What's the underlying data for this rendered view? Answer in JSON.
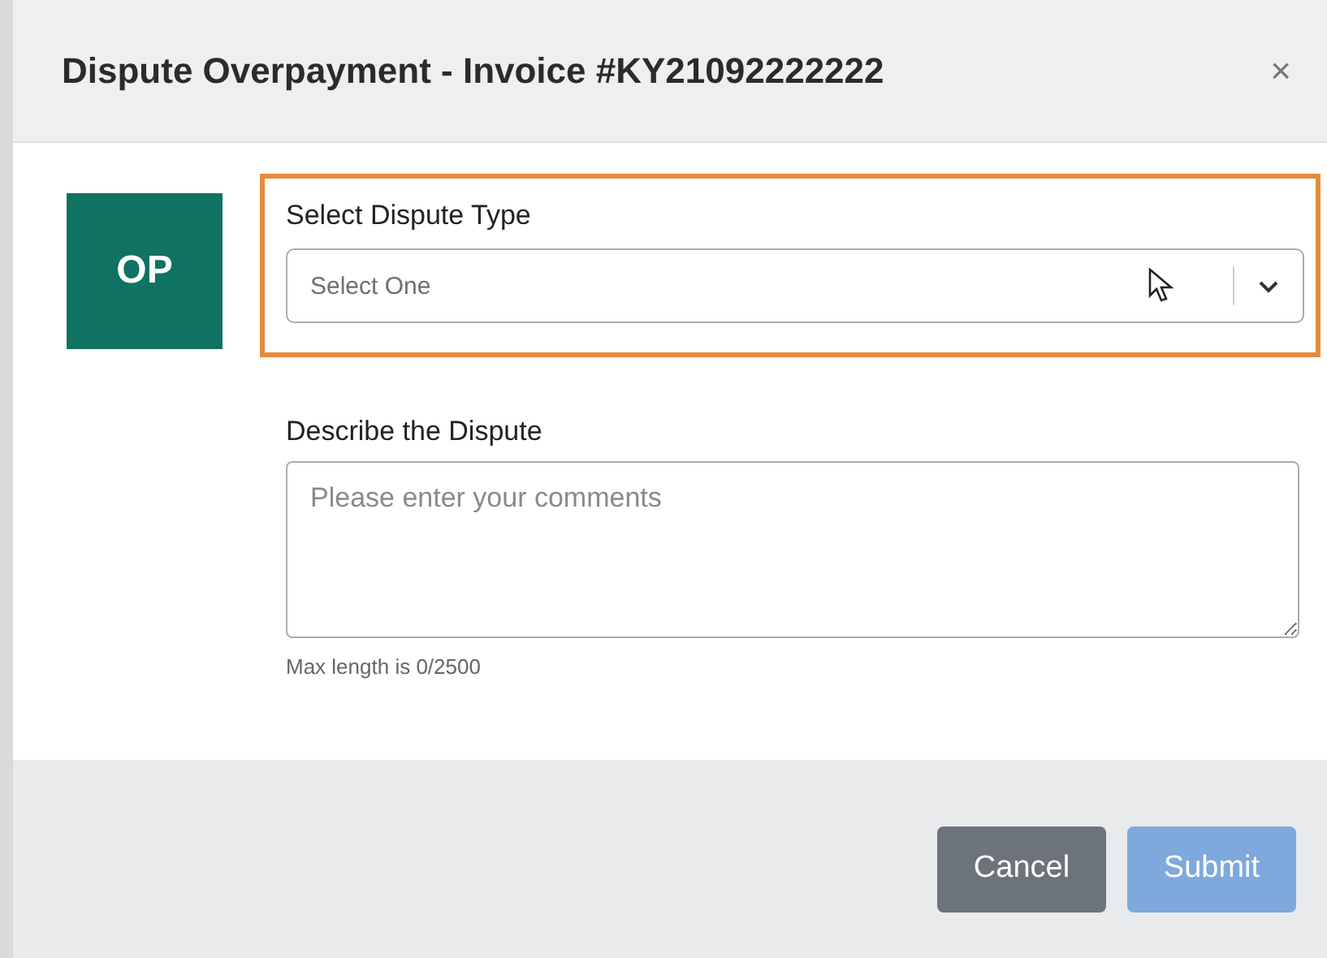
{
  "dialog": {
    "title": "Dispute Overpayment - Invoice #KY21092222222",
    "close": "×"
  },
  "badge": "OP",
  "dispute_type": {
    "label": "Select Dispute Type",
    "placeholder": "Select One",
    "highlighted": true
  },
  "description": {
    "label": "Describe the Dispute",
    "placeholder": "Please enter your comments",
    "hint": "Max length is 0/2500"
  },
  "buttons": [
    {
      "label": "Cancel",
      "kind": "secondary",
      "disabled": false
    },
    {
      "label": "Submit",
      "kind": "primary",
      "disabled": true
    }
  ]
}
